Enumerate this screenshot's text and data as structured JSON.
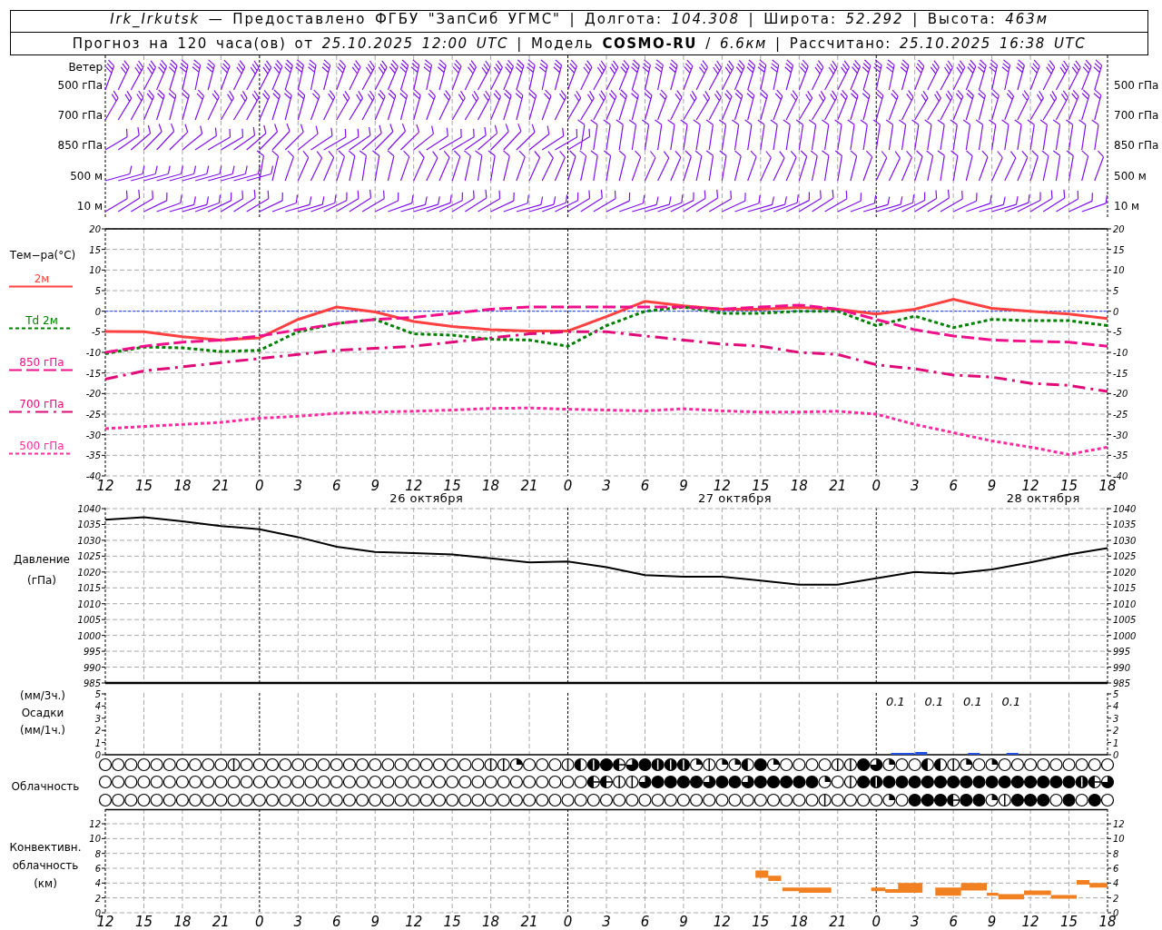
{
  "header": {
    "station_line": "*Irk_Irkutsk* — Предоставлено ФГБУ \"ЗапСиб УГМС\" | Долгота: *104.308* | Широта: *52.292* | Высота: *463м*",
    "forecast_line": "Прогноз на 120 часа(ов) от *25.10.2025 12:00 UTC* | Модель **COSMO-RU** / *6.6км* | Рассчитано: *25.10.2025 16:38 UTC*"
  },
  "wind": {
    "labels_left": [
      "Ветер",
      "500 гПа",
      "700 гПа",
      "850 гПа",
      "500 м",
      "10  м"
    ],
    "labels_right": [
      "500 гПа",
      "700 гПа",
      "850 гПа",
      "500 м",
      "10  м"
    ]
  },
  "temperature": {
    "label": "Тем−ра(°C)",
    "dates": [
      "26 октября",
      "27 октября",
      "28 октября"
    ],
    "right_ticks": [
      "20",
      "15",
      "10",
      "5",
      "0",
      "-5",
      "-10",
      "-15",
      "-20",
      "-25",
      "-30",
      "-35",
      "-40"
    ],
    "chart_data": {
      "type": "line",
      "grid": true,
      "ref_lines": [
        {
          "axis": "y",
          "value": 0,
          "color": "#2040ff"
        }
      ],
      "categories": [
        "12",
        "15",
        "18",
        "21",
        "0",
        "3",
        "6",
        "9",
        "12",
        "15",
        "18",
        "21",
        "0",
        "3",
        "6",
        "9",
        "12",
        "15",
        "18",
        "21",
        "0",
        "3",
        "6",
        "9",
        "12",
        "15",
        "18"
      ],
      "ylim": [
        -40,
        20
      ],
      "yticks": [
        -40,
        -35,
        -30,
        -25,
        -20,
        -15,
        -10,
        -5,
        0,
        5,
        10,
        15,
        20
      ],
      "series": [
        {
          "name": "2м",
          "color": "#ff4040",
          "line_style": "solid",
          "values": [
            -4.9,
            -5,
            -6.2,
            -7,
            -6.5,
            -2,
            1,
            -0.2,
            -2.5,
            -3.7,
            -4.5,
            -4.8,
            -4.8,
            -1.3,
            2.4,
            1.3,
            0.5,
            0.5,
            0.9,
            0.5,
            -0.7,
            0.5,
            2.9,
            0.7,
            0,
            -0.7,
            -1.8
          ]
        },
        {
          "name": "Td  2м",
          "color": "#008000",
          "line_style": "dotted",
          "values": [
            -10.3,
            -8.7,
            -8.9,
            -9.8,
            -9.5,
            -5,
            -3,
            -2,
            -5.5,
            -5.8,
            -6.8,
            -7,
            -8.5,
            -3.5,
            0,
            1,
            -0.5,
            -0.5,
            0,
            0,
            -3.5,
            -1.2,
            -4,
            -2,
            -2.3,
            -2.3,
            -3.5
          ]
        },
        {
          "name": "850 гПа",
          "color": "#f0108c",
          "line_style": "dashed",
          "values": [
            -10,
            -8.5,
            -7.5,
            -7,
            -6,
            -4.5,
            -3,
            -2,
            -1.5,
            -0.5,
            0.5,
            1,
            1,
            1,
            1,
            1,
            0.5,
            1,
            1.5,
            0.5,
            -2,
            -4.5,
            -6,
            -7,
            -7.3,
            -7.5,
            -8.5
          ]
        },
        {
          "name": "700 гПа",
          "color": "#e00a78",
          "line_style": "dashdot",
          "values": [
            -16.5,
            -14.5,
            -13.5,
            -12.5,
            -11.5,
            -10.5,
            -9.5,
            -9,
            -8.5,
            -7.5,
            -6.5,
            -5.5,
            -5,
            -5,
            -6,
            -7,
            -8,
            -8.5,
            -10,
            -10.5,
            -13,
            -14,
            -15.5,
            -16,
            -17.5,
            -18,
            -19.5
          ]
        },
        {
          "name": "500 гПа",
          "color": "#ff2aa0",
          "line_style": "dotted",
          "values": [
            -28.5,
            -28,
            -27.5,
            -27,
            -26,
            -25.5,
            -24.8,
            -24.5,
            -24.3,
            -24,
            -23.6,
            -23.5,
            -23.8,
            -24,
            -24.2,
            -23.7,
            -24.2,
            -24.5,
            -24.5,
            -24.3,
            -25,
            -27.5,
            -29.5,
            -31.5,
            -33,
            -34.8,
            -33
          ]
        }
      ]
    }
  },
  "pressure": {
    "labels": [
      "Давление",
      "(гПа)"
    ],
    "right_ticks": [
      "1040",
      "1035",
      "1030",
      "1025",
      "1020",
      "1015",
      "1010",
      "1005",
      "1000",
      "995",
      "990",
      "985"
    ],
    "chart_data": {
      "type": "line",
      "grid": true,
      "categories": [
        null,
        null,
        null,
        null,
        null,
        null,
        null,
        null,
        null,
        null,
        null,
        null,
        null,
        null,
        null,
        null,
        null,
        null,
        null,
        null,
        null,
        null,
        null,
        null,
        null,
        null,
        null
      ],
      "ylim": [
        985,
        1040
      ],
      "yticks": [
        985,
        990,
        995,
        1000,
        1005,
        1010,
        1015,
        1020,
        1025,
        1030,
        1035,
        1040
      ],
      "series": [
        {
          "color": "#000000",
          "values": [
            1036.5,
            1037.3,
            1036,
            1034.5,
            1033.5,
            1031,
            1028,
            1026.3,
            1026,
            1025.5,
            1024.3,
            1023,
            1023.3,
            1021.5,
            1019,
            1018.5,
            1018.5,
            1017.3,
            1016,
            1016,
            1018,
            1020,
            1019.5,
            1020.8,
            1023,
            1025.5,
            1027.5
          ]
        }
      ]
    }
  },
  "precipitation": {
    "labels": [
      "(мм/3ч.)",
      "Осадки",
      "(мм/1ч.)"
    ],
    "ticks": [
      "5",
      "4",
      "3",
      "2",
      "1",
      "0"
    ],
    "right_ticks": [
      "5",
      "4",
      "3",
      "2",
      "1",
      "0"
    ],
    "totals": [
      "0.1",
      "0.1",
      "0.1",
      "0.1"
    ]
  },
  "clouds": {
    "label": "Облачность",
    "rows": [
      {
        "cells": [
          {
            "kind": "clear"
          },
          {
            "kind": "clear"
          },
          {
            "kind": "clear"
          },
          {
            "kind": "clear"
          },
          {
            "kind": "clear"
          },
          {
            "kind": "clear"
          },
          {
            "kind": "clear"
          },
          {
            "kind": "clear"
          },
          {
            "kind": "clear"
          },
          {
            "kind": "clear"
          },
          {
            "kind": "trace"
          },
          {
            "kind": "clear"
          },
          {
            "kind": "clear"
          },
          {
            "kind": "clear"
          },
          {
            "kind": "clear"
          },
          {
            "kind": "clear"
          },
          {
            "kind": "clear"
          },
          {
            "kind": "clear"
          },
          {
            "kind": "clear"
          },
          {
            "kind": "clear"
          },
          {
            "kind": "clear"
          },
          {
            "kind": "clear"
          },
          {
            "kind": "clear"
          },
          {
            "kind": "clear"
          },
          {
            "kind": "clear"
          },
          {
            "kind": "clear"
          },
          {
            "kind": "clear"
          },
          {
            "kind": "clear"
          },
          {
            "kind": "clear"
          },
          {
            "kind": "clear"
          },
          {
            "kind": "trace"
          },
          {
            "kind": "trace"
          },
          {
            "kind": "quarter"
          },
          {
            "kind": "clear"
          },
          {
            "kind": "clear"
          },
          {
            "kind": "clear"
          },
          {
            "kind": "trace"
          },
          {
            "kind": "half"
          },
          {
            "kind": "nearfull"
          },
          {
            "kind": "full"
          },
          {
            "kind": "halfplus"
          },
          {
            "kind": "threequarter"
          },
          {
            "kind": "full"
          },
          {
            "kind": "nearfull"
          },
          {
            "kind": "nearfull"
          },
          {
            "kind": "nearfull"
          },
          {
            "kind": "quarter"
          },
          {
            "kind": "trace"
          },
          {
            "kind": "quarter"
          },
          {
            "kind": "quarter"
          },
          {
            "kind": "half"
          },
          {
            "kind": "full"
          },
          {
            "kind": "quarter"
          },
          {
            "kind": "clear"
          },
          {
            "kind": "clear"
          },
          {
            "kind": "clear"
          },
          {
            "kind": "clear"
          },
          {
            "kind": "trace"
          },
          {
            "kind": "trace"
          },
          {
            "kind": "full"
          },
          {
            "kind": "threequarter"
          },
          {
            "kind": "quarter"
          },
          {
            "kind": "clear"
          },
          {
            "kind": "clear"
          },
          {
            "kind": "half"
          },
          {
            "kind": "half"
          },
          {
            "kind": "trace"
          },
          {
            "kind": "quarter"
          },
          {
            "kind": "clear"
          },
          {
            "kind": "quarter"
          },
          {
            "kind": "clear"
          },
          {
            "kind": "clear"
          },
          {
            "kind": "clear"
          },
          {
            "kind": "clear"
          },
          {
            "kind": "clear"
          },
          {
            "kind": "clear"
          },
          {
            "kind": "clear"
          },
          {
            "kind": "clear"
          },
          {
            "kind": "clear"
          }
        ]
      },
      {
        "cells": [
          {
            "kind": "clear"
          },
          {
            "kind": "clear"
          },
          {
            "kind": "clear"
          },
          {
            "kind": "clear"
          },
          {
            "kind": "clear"
          },
          {
            "kind": "clear"
          },
          {
            "kind": "clear"
          },
          {
            "kind": "clear"
          },
          {
            "kind": "clear"
          },
          {
            "kind": "clear"
          },
          {
            "kind": "clear"
          },
          {
            "kind": "clear"
          },
          {
            "kind": "clear"
          },
          {
            "kind": "clear"
          },
          {
            "kind": "clear"
          },
          {
            "kind": "clear"
          },
          {
            "kind": "clear"
          },
          {
            "kind": "clear"
          },
          {
            "kind": "clear"
          },
          {
            "kind": "clear"
          },
          {
            "kind": "clear"
          },
          {
            "kind": "clear"
          },
          {
            "kind": "clear"
          },
          {
            "kind": "clear"
          },
          {
            "kind": "clear"
          },
          {
            "kind": "clear"
          },
          {
            "kind": "clear"
          },
          {
            "kind": "clear"
          },
          {
            "kind": "clear"
          },
          {
            "kind": "clear"
          },
          {
            "kind": "clear"
          },
          {
            "kind": "clear"
          },
          {
            "kind": "clear"
          },
          {
            "kind": "clear"
          },
          {
            "kind": "clear"
          },
          {
            "kind": "clear"
          },
          {
            "kind": "clear"
          },
          {
            "kind": "clear"
          },
          {
            "kind": "halfplus"
          },
          {
            "kind": "halfplus"
          },
          {
            "kind": "trace"
          },
          {
            "kind": "trace"
          },
          {
            "kind": "threequarter"
          },
          {
            "kind": "full"
          },
          {
            "kind": "full"
          },
          {
            "kind": "full"
          },
          {
            "kind": "full"
          },
          {
            "kind": "threequarter"
          },
          {
            "kind": "full"
          },
          {
            "kind": "full"
          },
          {
            "kind": "threequarter"
          },
          {
            "kind": "full"
          },
          {
            "kind": "full"
          },
          {
            "kind": "full"
          },
          {
            "kind": "full"
          },
          {
            "kind": "full"
          },
          {
            "kind": "quarter"
          },
          {
            "kind": "clear"
          },
          {
            "kind": "trace"
          },
          {
            "kind": "full"
          },
          {
            "kind": "nearfull"
          },
          {
            "kind": "full"
          },
          {
            "kind": "full"
          },
          {
            "kind": "full"
          },
          {
            "kind": "full"
          },
          {
            "kind": "full"
          },
          {
            "kind": "full"
          },
          {
            "kind": "full"
          },
          {
            "kind": "full"
          },
          {
            "kind": "full"
          },
          {
            "kind": "full"
          },
          {
            "kind": "full"
          },
          {
            "kind": "full"
          },
          {
            "kind": "full"
          },
          {
            "kind": "full"
          },
          {
            "kind": "full"
          },
          {
            "kind": "nearfull"
          },
          {
            "kind": "halfplus"
          },
          {
            "kind": "threequarter"
          }
        ]
      },
      {
        "cells": [
          {
            "kind": "clear"
          },
          {
            "kind": "clear"
          },
          {
            "kind": "clear"
          },
          {
            "kind": "clear"
          },
          {
            "kind": "clear"
          },
          {
            "kind": "clear"
          },
          {
            "kind": "clear"
          },
          {
            "kind": "clear"
          },
          {
            "kind": "clear"
          },
          {
            "kind": "clear"
          },
          {
            "kind": "clear"
          },
          {
            "kind": "clear"
          },
          {
            "kind": "clear"
          },
          {
            "kind": "clear"
          },
          {
            "kind": "clear"
          },
          {
            "kind": "clear"
          },
          {
            "kind": "clear"
          },
          {
            "kind": "clear"
          },
          {
            "kind": "clear"
          },
          {
            "kind": "clear"
          },
          {
            "kind": "clear"
          },
          {
            "kind": "clear"
          },
          {
            "kind": "clear"
          },
          {
            "kind": "clear"
          },
          {
            "kind": "clear"
          },
          {
            "kind": "clear"
          },
          {
            "kind": "clear"
          },
          {
            "kind": "clear"
          },
          {
            "kind": "clear"
          },
          {
            "kind": "clear"
          },
          {
            "kind": "clear"
          },
          {
            "kind": "clear"
          },
          {
            "kind": "clear"
          },
          {
            "kind": "clear"
          },
          {
            "kind": "clear"
          },
          {
            "kind": "clear"
          },
          {
            "kind": "clear"
          },
          {
            "kind": "clear"
          },
          {
            "kind": "clear"
          },
          {
            "kind": "clear"
          },
          {
            "kind": "clear"
          },
          {
            "kind": "clear"
          },
          {
            "kind": "clear"
          },
          {
            "kind": "clear"
          },
          {
            "kind": "clear"
          },
          {
            "kind": "clear"
          },
          {
            "kind": "clear"
          },
          {
            "kind": "clear"
          },
          {
            "kind": "clear"
          },
          {
            "kind": "clear"
          },
          {
            "kind": "clear"
          },
          {
            "kind": "clear"
          },
          {
            "kind": "clear"
          },
          {
            "kind": "clear"
          },
          {
            "kind": "clear"
          },
          {
            "kind": "clear"
          },
          {
            "kind": "trace"
          },
          {
            "kind": "clear"
          },
          {
            "kind": "clear"
          },
          {
            "kind": "clear"
          },
          {
            "kind": "clear"
          },
          {
            "kind": "quarter"
          },
          {
            "kind": "clear"
          },
          {
            "kind": "full"
          },
          {
            "kind": "full"
          },
          {
            "kind": "full"
          },
          {
            "kind": "halfplus"
          },
          {
            "kind": "full"
          },
          {
            "kind": "full"
          },
          {
            "kind": "quarter"
          },
          {
            "kind": "trace"
          },
          {
            "kind": "full"
          },
          {
            "kind": "full"
          },
          {
            "kind": "full"
          },
          {
            "kind": "clear"
          },
          {
            "kind": "full"
          },
          {
            "kind": "clear"
          },
          {
            "kind": "full"
          },
          {
            "kind": "clear"
          }
        ]
      }
    ]
  },
  "convective": {
    "labels": [
      "Конвективн.",
      "облачность",
      "(км)"
    ],
    "ticks": [
      "12",
      "10",
      "8",
      "6",
      "4",
      "2",
      "0"
    ],
    "right_ticks": [
      "12",
      "10",
      "8",
      "6",
      "4",
      "2",
      "0"
    ],
    "time_labels": [
      "12",
      "15",
      "18",
      "21",
      "0",
      "3",
      "6",
      "9",
      "12",
      "15",
      "18",
      "21",
      "0",
      "3",
      "6",
      "9",
      "12",
      "15",
      "18",
      "21",
      "0",
      "3",
      "6",
      "9",
      "12",
      "15",
      "18"
    ]
  }
}
